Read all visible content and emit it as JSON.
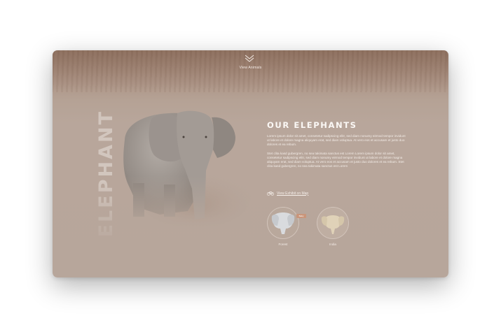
{
  "nav": {
    "scroll_label": "View Animals",
    "arrow_icon": "double-chevron-down-icon"
  },
  "hero": {
    "vertical_word": "ELEPHANT"
  },
  "info": {
    "title": "OUR ELEPHANTS",
    "paragraph_1": "Lorem ipsum dolor sit amet, consetetur sadipscing elitr, sed diam nonumy eirmod tempor invidunt ut labore et dolore magna aliquyam erat, sed diam voluptua. At vero eos et accusam et justo duo dolores et ea rebum.",
    "paragraph_2": "Stet clita kasd gubergren, no sea takimata sanctus est Lorem Lorem ipsum dolor sit amet, consetetur sadipscing elitr, sed diam nonumy eirmod tempor invidunt ut labore et dolore magna aliquyam erat, sed diam voluptua. At vero eos et accusam et justo duo dolores et ea rebum. Stet clita kasd gubergren, no sea takimata sanctus est Lorem",
    "exhibit_link": "View Exhibit on Map",
    "exhibit_icon": "bicycle-icon"
  },
  "species": [
    {
      "label": "Forest",
      "badge": "Baby"
    },
    {
      "label": "India"
    }
  ]
}
